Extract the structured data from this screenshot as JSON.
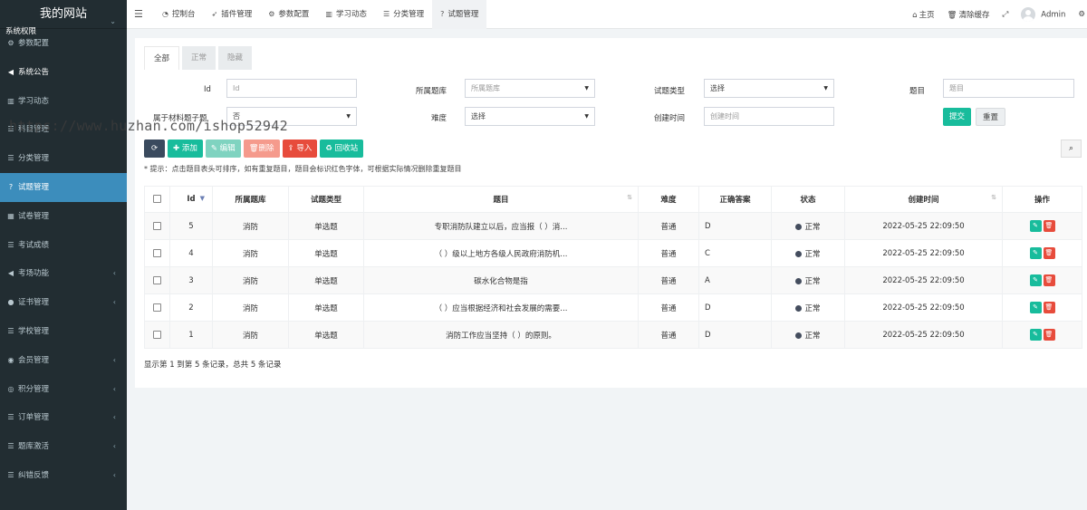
{
  "sidebar": {
    "logo": "我的网站",
    "clipped_item": "系统权限",
    "items": [
      {
        "label": "参数配置",
        "icon": "gears-icon"
      },
      {
        "label": "系统公告",
        "icon": "bullhorn-icon"
      },
      {
        "label": "学习动态",
        "icon": "map-icon"
      },
      {
        "label": "科目管理",
        "icon": "list-icon"
      },
      {
        "label": "分类管理",
        "icon": "list-icon"
      },
      {
        "label": "试题管理",
        "icon": "question-circle-icon"
      },
      {
        "label": "试卷管理",
        "icon": "keyboard-icon"
      },
      {
        "label": "考试成绩",
        "icon": "list-icon"
      },
      {
        "label": "考场功能",
        "icon": "bullhorn-icon"
      },
      {
        "label": "证书管理",
        "icon": "circle-icon"
      },
      {
        "label": "学校管理",
        "icon": "list-icon"
      },
      {
        "label": "会员管理",
        "icon": "user-circle-icon"
      },
      {
        "label": "积分管理",
        "icon": "gift-icon"
      },
      {
        "label": "订单管理",
        "icon": "list-icon"
      },
      {
        "label": "题库激活",
        "icon": "list-icon"
      },
      {
        "label": "纠错反馈",
        "icon": "list-icon"
      }
    ]
  },
  "topbar": {
    "tabs": [
      {
        "label": "控制台",
        "icon": "dashboard-icon"
      },
      {
        "label": "插件管理",
        "icon": "rocket-icon"
      },
      {
        "label": "参数配置",
        "icon": "gears-icon"
      },
      {
        "label": "学习动态",
        "icon": "map-icon"
      },
      {
        "label": "分类管理",
        "icon": "list-icon"
      },
      {
        "label": "试题管理",
        "icon": "question-circle-icon"
      }
    ],
    "home": "主页",
    "clear_cache": "清除缓存",
    "user": "Admin"
  },
  "filter_tabs": [
    "全部",
    "正常",
    "隐藏"
  ],
  "filters": {
    "id_label": "Id",
    "id_placeholder": "Id",
    "bank_label": "所属题库",
    "bank_placeholder": "所属题库",
    "type_label": "试题类型",
    "type_value": "选择",
    "title_label": "题目",
    "title_placeholder": "题目",
    "material_label": "属于材料题子题",
    "material_value": "否",
    "difficulty_label": "难度",
    "difficulty_value": "选择",
    "created_label": "创建时间",
    "created_placeholder": "创建时间",
    "submit": "提交",
    "reset": "重置"
  },
  "toolbar": {
    "add": "添加",
    "edit": "编辑",
    "delete": "删除",
    "import": "导入",
    "recycle": "回收站"
  },
  "tip": "* 提示：点击题目表头可排序，如有重复题目，题目会标识红色字体，可根据实际情况删除重复题目",
  "watermark": "https://www.huzhan.com/ishop52942",
  "table": {
    "headers": [
      "Id",
      "所属题库",
      "试题类型",
      "题目",
      "难度",
      "正确答案",
      "状态",
      "创建时间",
      "操作"
    ],
    "rows": [
      {
        "id": "5",
        "bank": "消防",
        "type": "单选题",
        "title": "专职消防队建立以后，应当报（ ）消...",
        "difficulty": "普通",
        "answer": "D",
        "status": "正常",
        "created": "2022-05-25 22:09:50"
      },
      {
        "id": "4",
        "bank": "消防",
        "type": "单选题",
        "title": "（ ）级以上地方各级人民政府消防机...",
        "difficulty": "普通",
        "answer": "C",
        "status": "正常",
        "created": "2022-05-25 22:09:50"
      },
      {
        "id": "3",
        "bank": "消防",
        "type": "单选题",
        "title": "碳水化合物是指",
        "difficulty": "普通",
        "answer": "A",
        "status": "正常",
        "created": "2022-05-25 22:09:50"
      },
      {
        "id": "2",
        "bank": "消防",
        "type": "单选题",
        "title": "（ ）应当根据经济和社会发展的需要...",
        "difficulty": "普通",
        "answer": "D",
        "status": "正常",
        "created": "2022-05-25 22:09:50"
      },
      {
        "id": "1",
        "bank": "消防",
        "type": "单选题",
        "title": "消防工作应当坚持（ ）的原则。",
        "difficulty": "普通",
        "answer": "D",
        "status": "正常",
        "created": "2022-05-25 22:09:50"
      }
    ]
  },
  "pager": "显示第 1 到第 5 条记录，总共 5 条记录"
}
